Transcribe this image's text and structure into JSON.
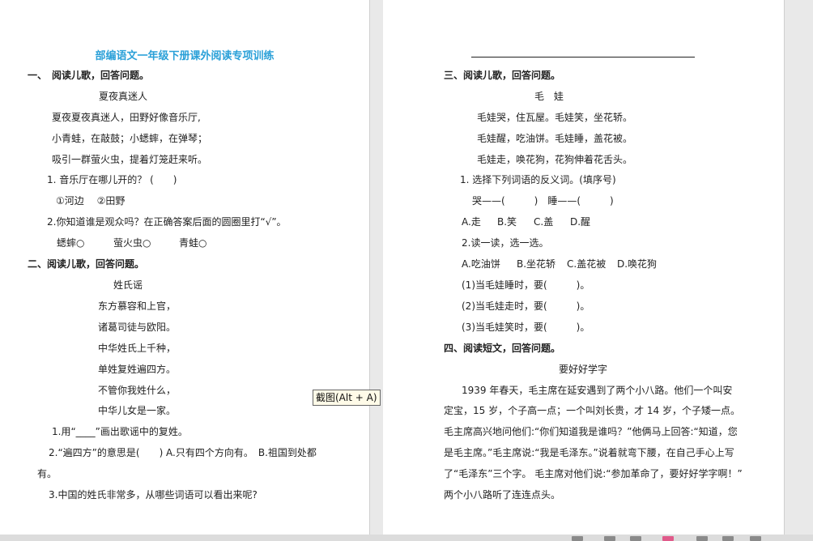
{
  "left": {
    "title": "部编语文一年级下册课外阅读专项训练",
    "s1_heading": "一、　阅读儿歌，回答问题。",
    "s1_poem_title": "夏夜真迷人",
    "s1_poem": [
      "夏夜夏夜真迷人，田野好像音乐厅,",
      "小青蛙，在敲鼓；小蟋蟀，在弹琴；",
      "吸引一群萤火虫，提着灯笼赶来听。"
    ],
    "s1_q1": "1. 音乐厅在哪儿开的？ (　　)",
    "s1_q1_opts": "①河边　 ②田野",
    "s1_q2": "2.你知道谁是观众吗？在正确答案后面的圆圈里打“√”。",
    "s1_q2_opts": [
      "蟋蟀○",
      "萤火虫○",
      "青蛙○"
    ],
    "s2_heading": "二、阅读儿歌，回答问题。",
    "s2_poem_title": "姓氏谣",
    "s2_poem": [
      "东方慕容和上官，",
      "诸葛司徒与欧阳。",
      "中华姓氏上千种，",
      "单姓复姓遍四方。",
      "不管你我姓什么，",
      "中华儿女是一家。"
    ],
    "s2_q1": "1.用“____”画出歌谣中的复姓。",
    "s2_q2_a": "2.“遍四方”的意思是(　　) A.只有四个方向有。　B.祖国到处都",
    "s2_q2_b": "有。",
    "s2_q3": "3.中国的姓氏非常多，从哪些词语可以看出来呢?"
  },
  "right": {
    "s3_heading": "三、阅读儿歌，回答问题。",
    "s3_poem_title": "毛　娃",
    "s3_poem": [
      "毛娃哭，住瓦屋。毛娃笑，坐花轿。",
      "毛娃醒，吃油饼。毛娃睡，盖花被。",
      "毛娃走，唤花狗，花狗伸着花舌头。"
    ],
    "s3_q1": "1. 选择下列词语的反义词。(填序号)",
    "s3_q1_pairs": "哭——(　　　)　睡——(　　　)",
    "s3_q1_opts": [
      "A.走",
      "B.笑",
      "C.盖",
      "D.醒"
    ],
    "s3_q2": "2.读一读，选一选。",
    "s3_q2_opts": [
      "A.吃油饼",
      "B.坐花轿",
      "C.盖花被",
      "D.唤花狗"
    ],
    "s3_q2_items": [
      "(1)当毛娃睡时，要(　　　)。",
      "(2)当毛娃走时，要(　　　)。",
      "(3)当毛娃笑时，要(　　　)。"
    ],
    "s4_heading": "四、阅读短文，回答问题。",
    "s4_title": "要好好学字",
    "s4_lines": [
      "1939 年春天，毛主席在延安遇到了两个小八路。他们一个叫安",
      "定宝，15 岁，个子高一点；一个叫刘长贵，才 14 岁，个子矮一点。",
      "毛主席高兴地问他们:“你们知道我是谁吗？”他俩马上回答:“知道，您",
      "是毛主席。”毛主席说:“我是毛泽东。”说着就弯下腰，在自己手心上写",
      "了“毛泽东”三个字。 毛主席对他们说:“参加革命了，要好好学字啊！”",
      "两个小八路听了连连点头。"
    ]
  },
  "tooltip": "截图(Alt + A)"
}
